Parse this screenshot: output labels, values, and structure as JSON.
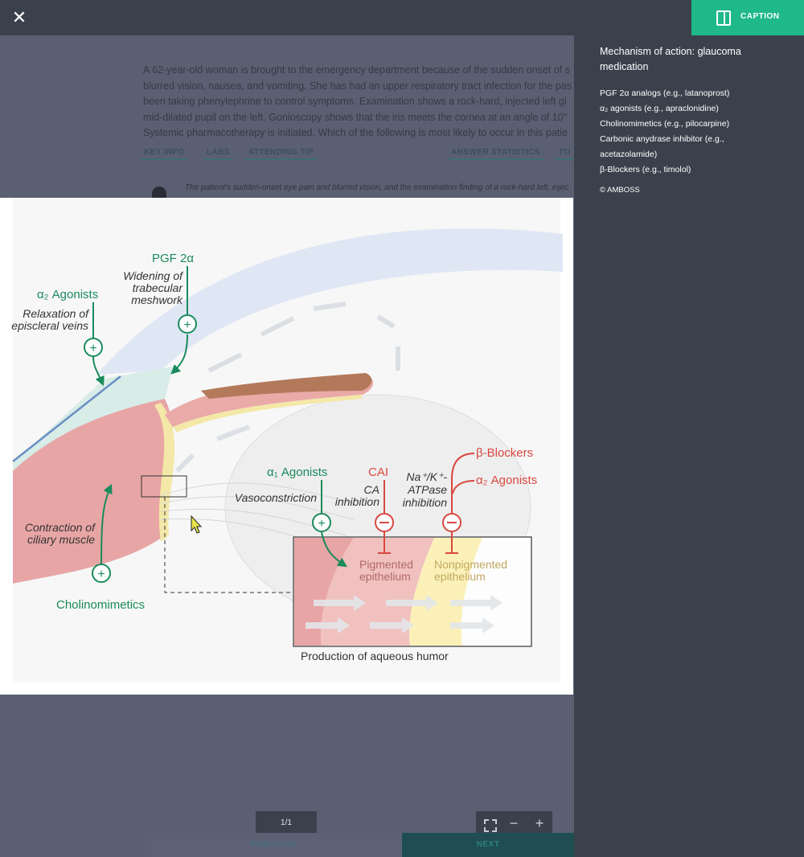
{
  "window": {
    "close_icon": "close-icon",
    "caption_button": {
      "label": "CAPTION",
      "icon": "sidebar-panel-icon",
      "color": "#1fb889"
    }
  },
  "background_question": {
    "lines": [
      "A 62-year-old woman is brought to the emergency department because of the sudden onset of s",
      "blurred vision, nausea, and vomiting. She has had an upper respiratory tract infection for the pas",
      "been taking phenylephrine to control symptoms. Examination shows a rock-hard, injected left gl",
      "mid-dilated pupil on the left. Gonioscopy shows that the iris meets the cornea at an angle of 10°",
      "Systemic pharmacotherapy is initiated. Which of the following is most likely to occur in this patie"
    ],
    "tabs": [
      "KEY INFO",
      "LABS",
      "ATTENDING TIP",
      "ANSWER STATISTICS",
      "TO"
    ],
    "explanation": "The patient's sudden-onset eye pain and blurred vision, and the examination finding of a rock-hard left, injec"
  },
  "caption": {
    "title": "Mechanism of action: glaucoma medication",
    "items": [
      "PGF 2α analogs (e.g., latanoprost)",
      "α₂ agonists (e.g., apraclonidine)",
      "Cholinomimetics (e.g., pilocarpine)",
      "Carbonic anydrase inhibitor (e.g.,",
      "acetazolamide)",
      "β-Blockers (e.g., timolol)"
    ],
    "copyright": "© AMBOSS"
  },
  "figure": {
    "labels": {
      "pgf": "PGF 2α",
      "widening": [
        "Widening of",
        "trabecular",
        "meshwork"
      ],
      "a2_left": "α₂ Agonists",
      "relaxation": [
        "Relaxation of",
        "episcleral veins"
      ],
      "contraction": [
        "Contraction of",
        "ciliary muscle"
      ],
      "cholinomimetics": "Cholinomimetics",
      "a1": "α₁ Agonists",
      "vasoconstriction": "Vasoconstriction",
      "cai": "CAI",
      "ca_inhibition": [
        "CA",
        "inhibition"
      ],
      "atpase": [
        "Na⁺/K⁺-",
        "ATPase",
        "inhibition"
      ],
      "beta_blockers": "β-Blockers",
      "a2_right": "α₂ Agonists",
      "pigmented": [
        "Pigmented",
        "epithelium"
      ],
      "nonpigmented": [
        "Nonpigmented",
        "epithelium"
      ],
      "production": "Production of aqueous humor"
    },
    "colors": {
      "green": "#1a8a5c",
      "red": "#d9473f",
      "muscle": "#e8a5a5",
      "cornea": "#dfe7f5",
      "lens": "#eeeeee"
    }
  },
  "footer": {
    "pager": "1/1",
    "zoom_icons": [
      "fullscreen-icon",
      "zoom-out-icon",
      "zoom-in-icon"
    ],
    "prev": "PREVIOUS",
    "next": "NEXT"
  }
}
